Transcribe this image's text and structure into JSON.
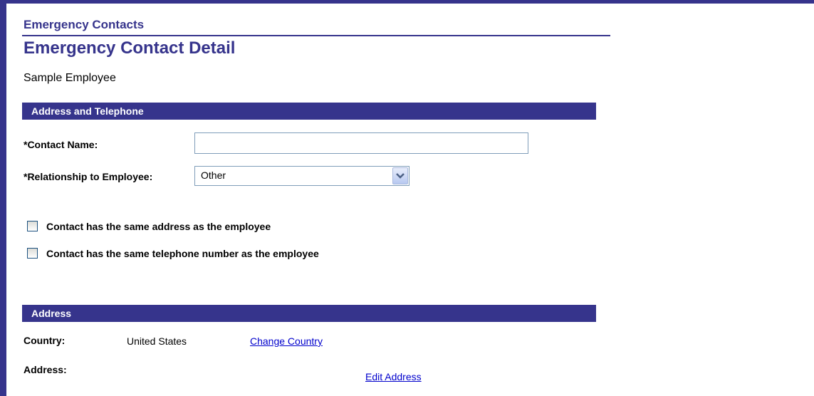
{
  "header": {
    "section_title": "Emergency Contacts",
    "page_title": "Emergency Contact Detail",
    "employee_name": "Sample Employee"
  },
  "address_telephone": {
    "bar_title": "Address and Telephone",
    "contact_name_label": "*Contact Name:",
    "contact_name_value": "",
    "relationship_label": "*Relationship to Employee:",
    "relationship_value": "Other",
    "same_address_label": "Contact has the same address as the employee",
    "same_address_checked": false,
    "same_phone_label": "Contact has the same telephone number as the employee",
    "same_phone_checked": false
  },
  "address": {
    "bar_title": "Address",
    "country_label": "Country:",
    "country_value": "United States",
    "change_country_link": "Change Country",
    "address_label": "Address:",
    "edit_address_link": "Edit Address"
  },
  "colors": {
    "brand": "#36348c",
    "link": "#0000cc"
  }
}
